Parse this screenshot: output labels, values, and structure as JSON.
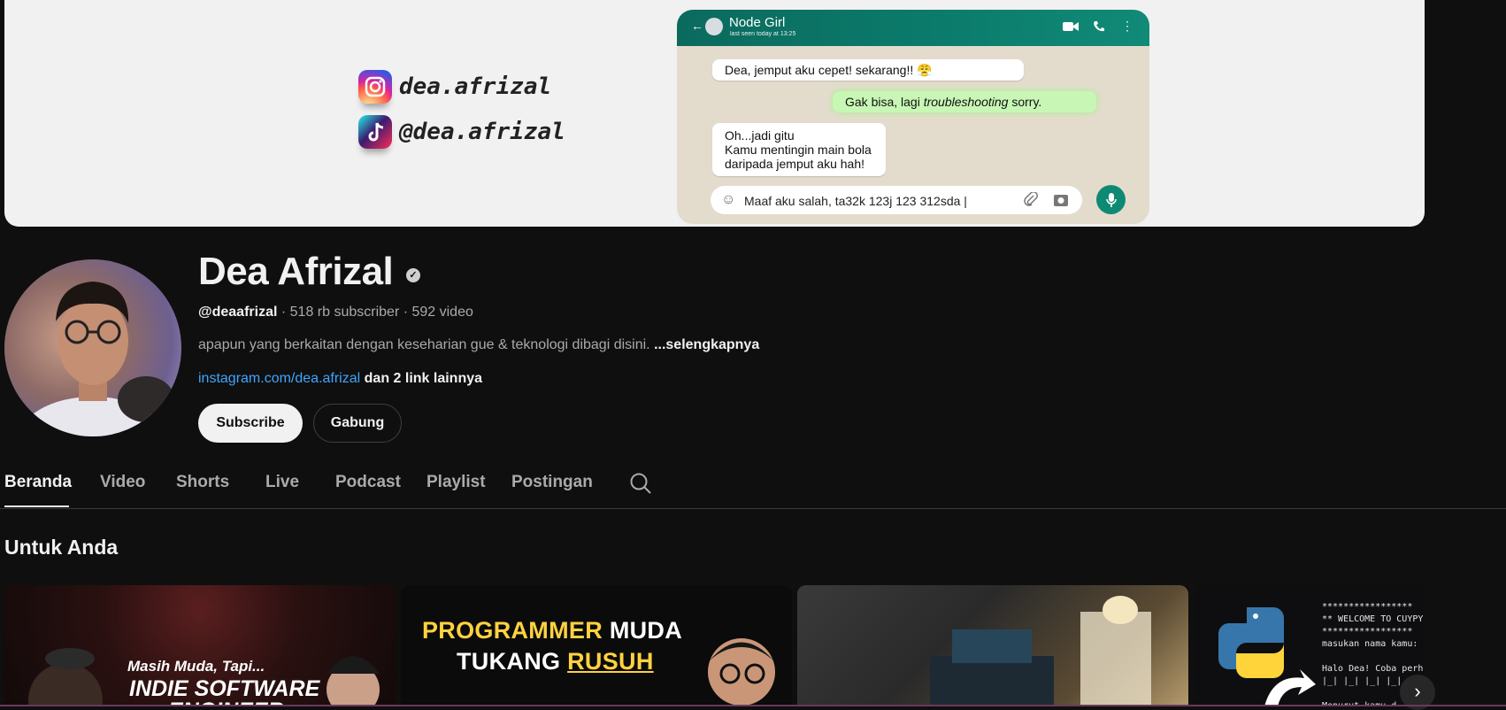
{
  "banner": {
    "instagram_handle": "dea.afrizal",
    "tiktok_handle": "@dea.afrizal",
    "chat": {
      "contact_name": "Node Girl",
      "last_seen": "last seen today at 13:25",
      "messages": [
        {
          "text": "Dea, jemput aku cepet! sekarang!! 😤"
        },
        {
          "prefix": "Gak bisa, lagi ",
          "italic": "troubleshooting",
          "suffix": " sorry."
        },
        {
          "line1": "Oh...jadi gitu",
          "line2": "Kamu mentingin main bola",
          "line3": "daripada jemput aku hah!"
        }
      ],
      "input_text": "Maaf aku salah, ta32k 123j 123 312sda  |"
    }
  },
  "channel": {
    "name": "Dea Afrizal",
    "handle": "@deaafrizal",
    "stats": "· 518 rb subscriber · 592 video",
    "description": "apapun yang berkaitan dengan keseharian gue & teknologi dibagi disini.",
    "more_label": "...selengkapnya",
    "link_text": "instagram.com/dea.afrizal",
    "link_more": "dan 2 link lainnya",
    "subscribe_label": "Subscribe",
    "join_label": "Gabung"
  },
  "tabs": [
    "Beranda",
    "Video",
    "Shorts",
    "Live",
    "Podcast",
    "Playlist",
    "Postingan"
  ],
  "active_tab": "Beranda",
  "section": {
    "title": "Untuk Anda",
    "thumbs": {
      "t1_line1": "Masih Muda, Tapi...",
      "t1_line2": "INDIE SOFTWARE",
      "t1_line3": "ENGINEER",
      "t2_word1": "PROGRAMMER",
      "t2_word2": "MUDA",
      "t2_word3": "TUKANG",
      "t2_word4": "RUSUH",
      "t4_code": "*****************\n** WELCOME TO CUYPY\n*****************\nmasukan nama kamu:\n\nHalo Dea! Coba perh\n|_| |_| |_| |_|\n\nMenurut kamu d"
    }
  },
  "colors": {
    "background": "#0f0f0f",
    "link": "#3ea6ff",
    "text_secondary": "#aaaaaa"
  }
}
